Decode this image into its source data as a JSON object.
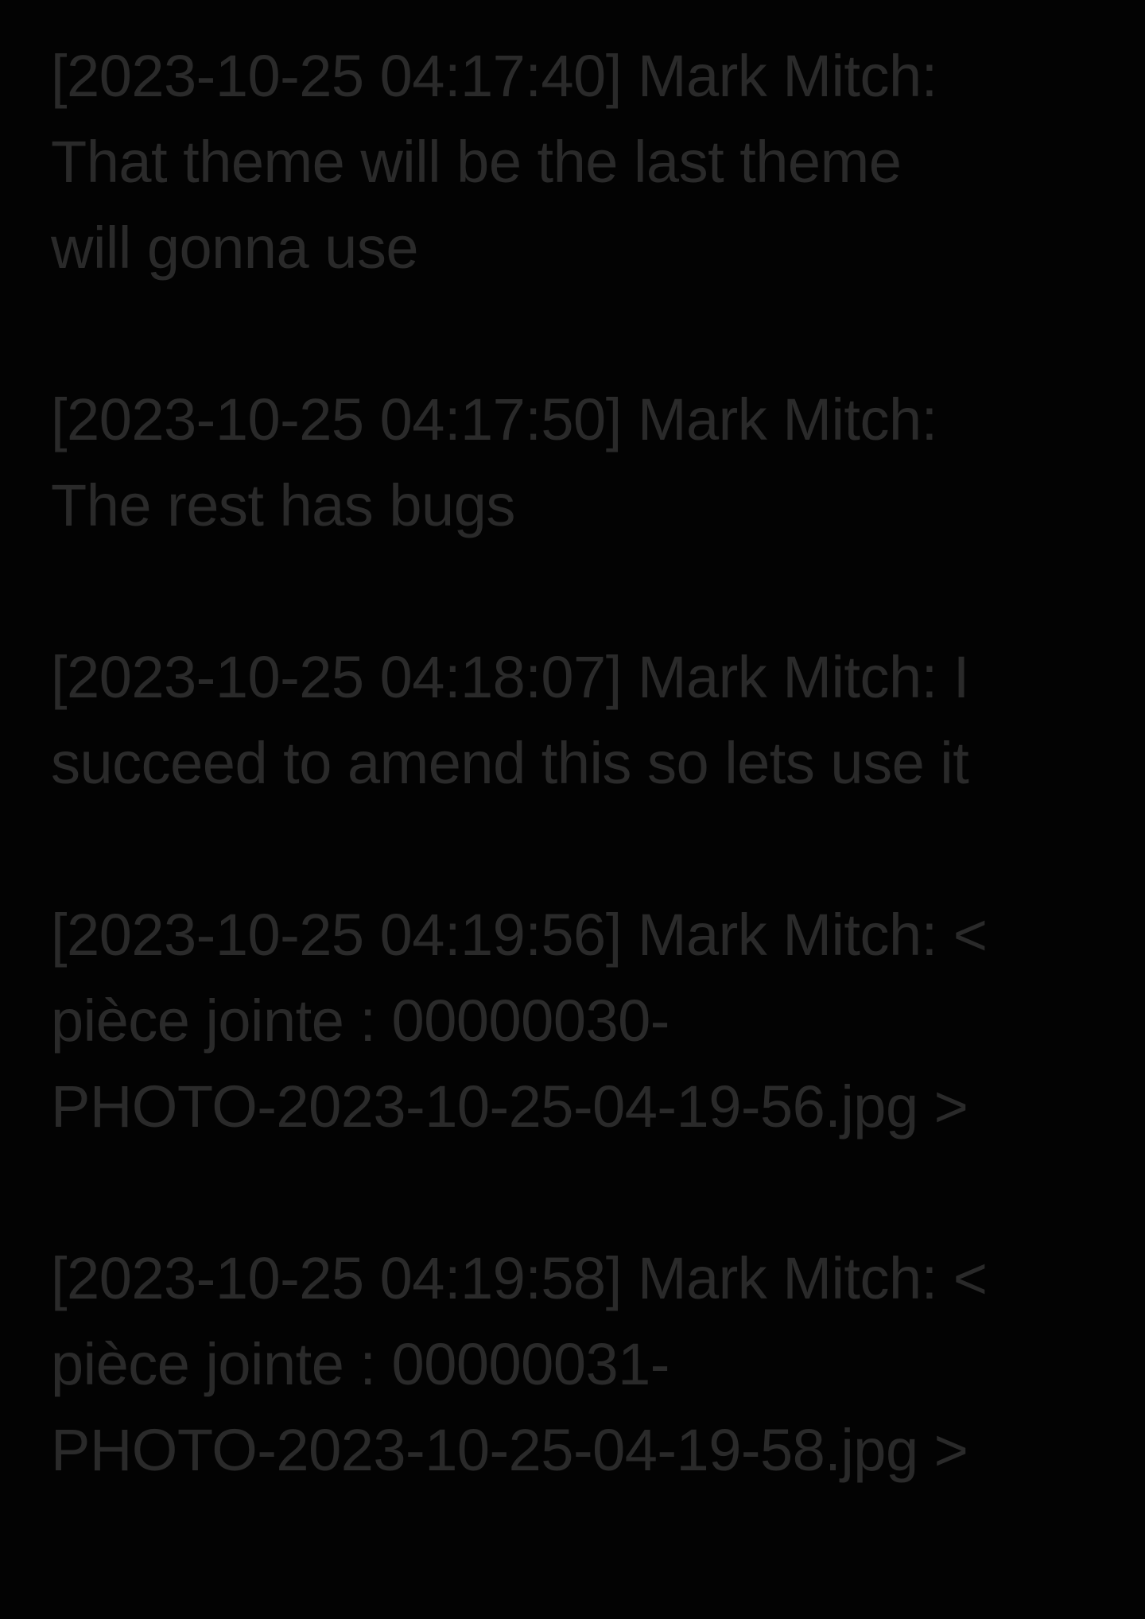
{
  "messages": [
    {
      "lines": [
        "[2023-10-25 04:17:40] Mark Mitch:",
        "That theme will be the last theme",
        "will gonna use"
      ]
    },
    {
      "lines": [
        "[2023-10-25 04:17:50] Mark Mitch:",
        "The rest has bugs"
      ]
    },
    {
      "lines": [
        "[2023-10-25 04:18:07] Mark Mitch: I",
        "succeed to amend this so lets use it"
      ]
    },
    {
      "lines": [
        "[2023-10-25 04:19:56] Mark Mitch: <",
        "pièce jointe : 00000030-",
        "PHOTO-2023-10-25-04-19-56.jpg >"
      ]
    },
    {
      "lines": [
        "[2023-10-25 04:19:58] Mark Mitch: <",
        "pièce jointe : 00000031-",
        "PHOTO-2023-10-25-04-19-58.jpg >"
      ]
    }
  ]
}
